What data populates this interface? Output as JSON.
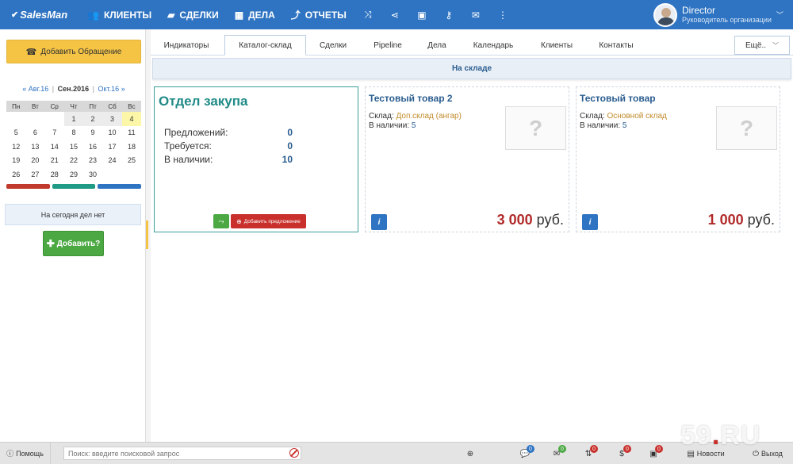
{
  "app": {
    "logo": "SalesMan"
  },
  "nav": {
    "items": [
      {
        "label": "КЛИЕНТЫ",
        "icon": "users-icon"
      },
      {
        "label": "СДЕЛКИ",
        "icon": "handshake-icon"
      },
      {
        "label": "ДЕЛА",
        "icon": "calendar-icon"
      },
      {
        "label": "ОТЧЕТЫ",
        "icon": "chart-line-icon"
      }
    ],
    "icons": [
      "shuffle-icon",
      "share-icon",
      "briefcase-icon",
      "key-icon",
      "envelope-icon",
      "more-vertical-icon"
    ]
  },
  "user": {
    "name": "Director",
    "role": "Руководитель организации"
  },
  "sidebar": {
    "add_request_label": "Добавить Обращение",
    "calendar": {
      "prev_month": "Авг.16",
      "current_month": "Сен.2016",
      "next_month": "Окт.16",
      "weekdays": [
        "Пн",
        "Вт",
        "Ср",
        "Чт",
        "Пт",
        "Сб",
        "Вс"
      ],
      "weeks": [
        [
          "",
          "",
          "",
          "1",
          "2",
          "3",
          "4"
        ],
        [
          "5",
          "6",
          "7",
          "8",
          "9",
          "10",
          "11"
        ],
        [
          "12",
          "13",
          "14",
          "15",
          "16",
          "17",
          "18"
        ],
        [
          "19",
          "20",
          "21",
          "22",
          "23",
          "24",
          "25"
        ],
        [
          "26",
          "27",
          "28",
          "29",
          "30",
          "",
          ""
        ]
      ],
      "today": "4",
      "bar_colors": [
        "#c0392b",
        "#1f9a84",
        "#2f74c2"
      ]
    },
    "today_text": "На сегодня дел нет",
    "add_task_label": "Добавить?"
  },
  "tabs": {
    "items": [
      "Индикаторы",
      "Каталог-склад",
      "Сделки",
      "Pipeline",
      "Дела",
      "Календарь",
      "Клиенты",
      "Контакты"
    ],
    "active": "Каталог-склад",
    "more_label": "Ещё.."
  },
  "section": {
    "title": "На складе"
  },
  "department": {
    "title": "Отдел закупа",
    "stats": [
      {
        "label": "Предложений:",
        "value": "0"
      },
      {
        "label": "Требуется:",
        "value": "0"
      },
      {
        "label": "В наличии:",
        "value": "10"
      }
    ],
    "add_offer_label": "Добавить предложение"
  },
  "products": [
    {
      "title": "Тестовый товар 2",
      "warehouse_label": "Склад:",
      "warehouse": "Доп.склад (ангар)",
      "stock_label": "В наличии:",
      "stock": "5",
      "price": "3 000",
      "currency": "руб."
    },
    {
      "title": "Тестовый товар",
      "warehouse_label": "Склад:",
      "warehouse": "Основной склад",
      "stock_label": "В наличии:",
      "stock": "5",
      "price": "1 000",
      "currency": "руб."
    }
  ],
  "bottom": {
    "help_label": "Помощь",
    "search_placeholder": "Поиск: введите поисковой запрос",
    "counters": [
      "0",
      "0",
      "0",
      "0",
      "0"
    ],
    "news_label": "Новости",
    "logout_label": "Выход"
  },
  "watermark": "59.RU"
}
